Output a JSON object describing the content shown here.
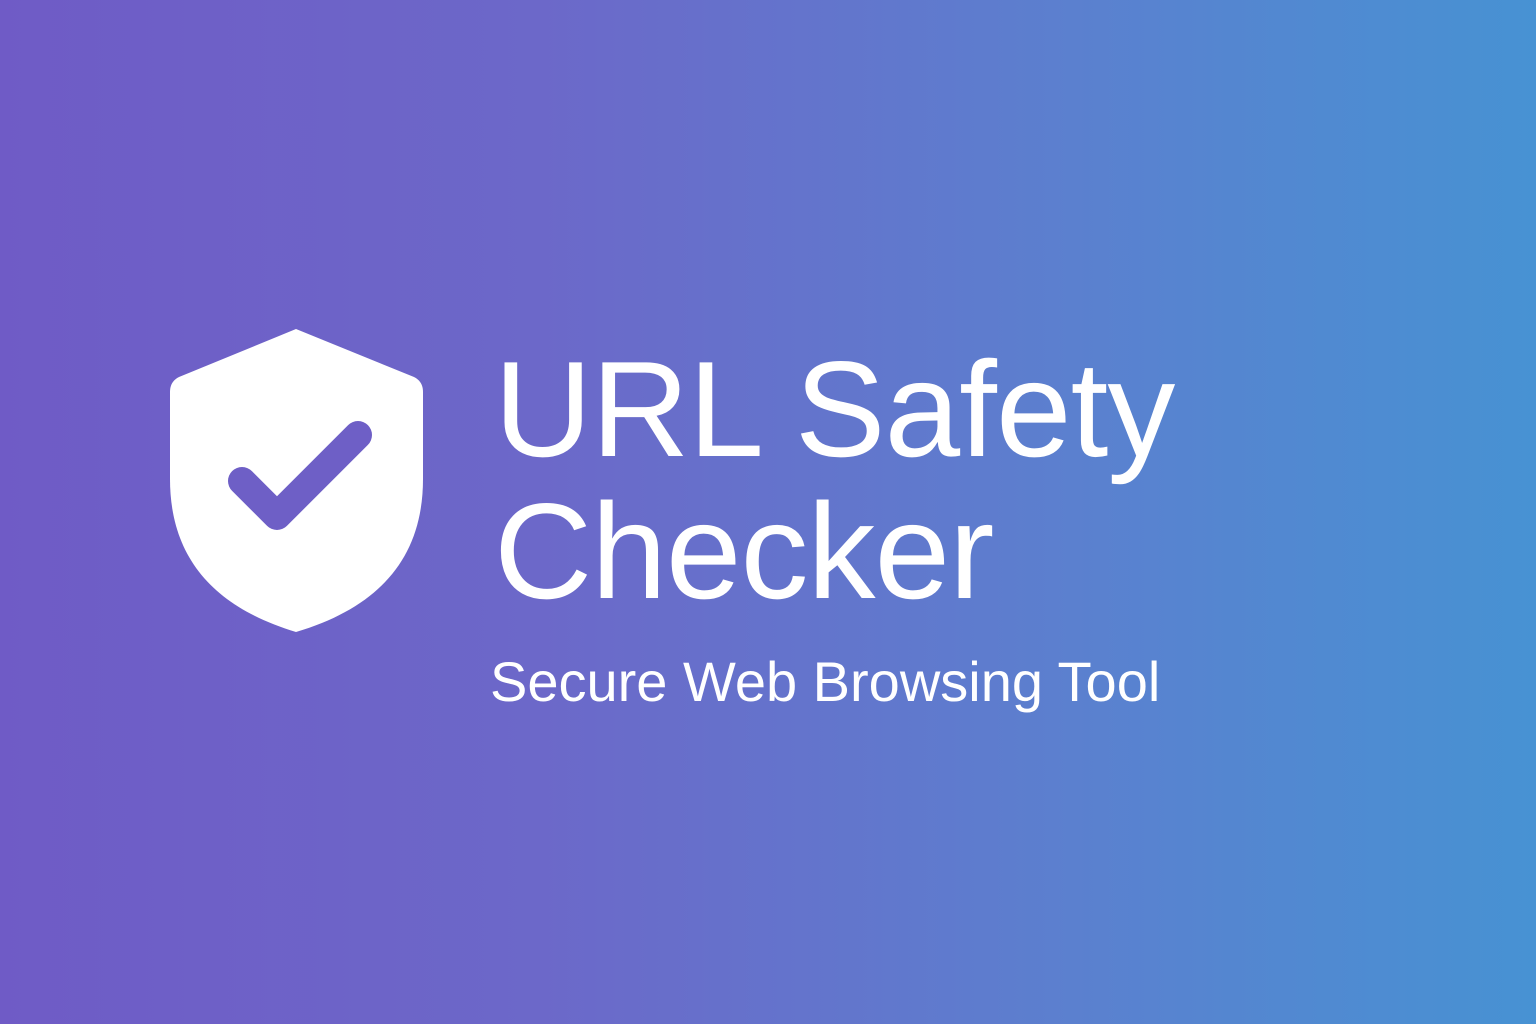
{
  "banner": {
    "title_line1": "URL Safety",
    "title_line2": "Checker",
    "subtitle": "Secure Web Browsing Tool",
    "logo_icon": "shield-check-icon",
    "colors": {
      "gradient_start": "#6f5bc6",
      "gradient_end": "#4792d3",
      "text": "#ffffff",
      "check_mark": "#6e5fc6"
    }
  }
}
